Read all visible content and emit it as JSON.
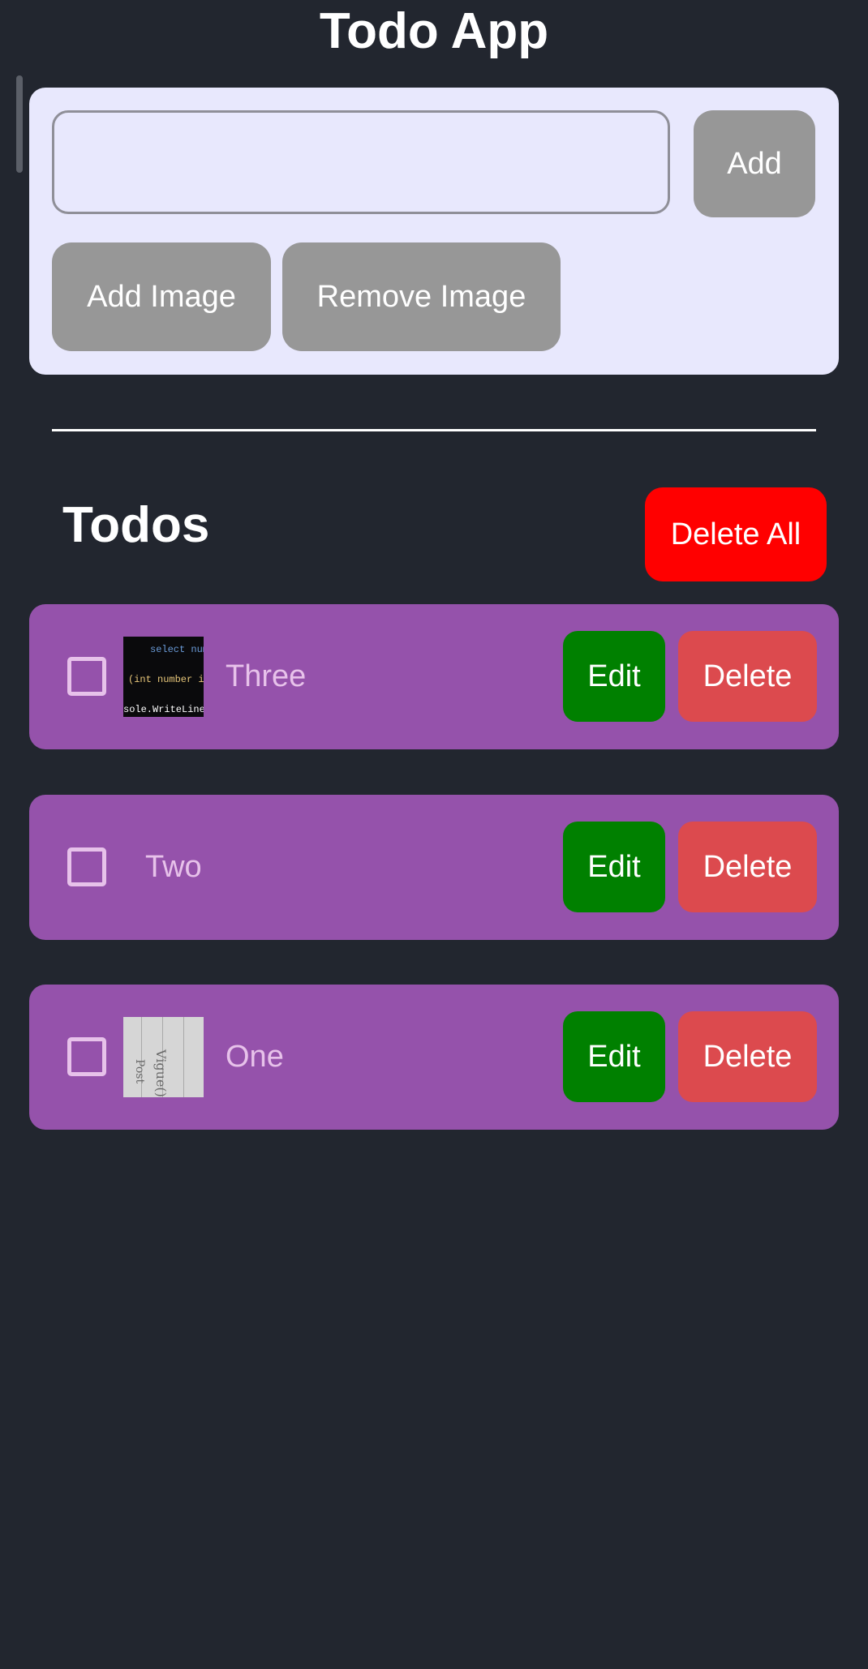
{
  "app": {
    "title": "Todo App"
  },
  "input_section": {
    "input_value": "",
    "add_label": "Add",
    "add_image_label": "Add Image",
    "remove_image_label": "Remove Image"
  },
  "todos_section": {
    "title": "Todos",
    "delete_all_label": "Delete All"
  },
  "todos": [
    {
      "text": "Three",
      "checked": false,
      "has_image": true,
      "image_kind": "code screenshot",
      "image_lines": [
        "select num",
        "(int number in",
        "sole.WriteLine("
      ],
      "edit_label": "Edit",
      "delete_label": "Delete"
    },
    {
      "text": "Two",
      "checked": false,
      "has_image": false,
      "edit_label": "Edit",
      "delete_label": "Delete"
    },
    {
      "text": "One",
      "checked": false,
      "has_image": true,
      "image_kind": "handwritten note photo",
      "image_lines": [
        "Vigue();",
        "Post"
      ],
      "edit_label": "Edit",
      "delete_label": "Delete"
    }
  ],
  "colors": {
    "background": "#22262f",
    "input_card": "#e8e8fd",
    "gray_button": "#979797",
    "delete_all": "#ff0000",
    "todo_card": "#9552ab",
    "todo_text": "#e7c2ea",
    "edit_button": "#008000",
    "delete_button": "#dc4a4e"
  }
}
